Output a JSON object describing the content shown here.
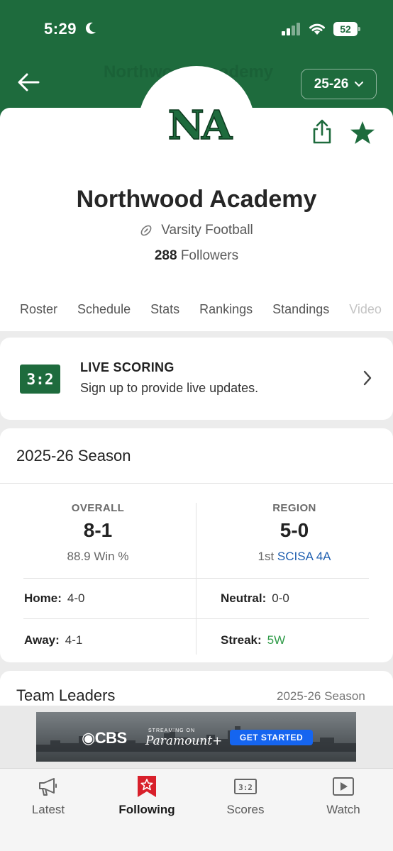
{
  "status_bar": {
    "time": "5:29",
    "battery": "52"
  },
  "header": {
    "back_label": "back",
    "ghost_title": "Northwood Academy",
    "season_selector": "25-26",
    "logo_text": "NA"
  },
  "team": {
    "name": "Northwood Academy",
    "sport": "Varsity Football",
    "followers_count": "288",
    "followers_label": "Followers"
  },
  "tabs": [
    "Roster",
    "Schedule",
    "Stats",
    "Rankings",
    "Standings",
    "Video"
  ],
  "live_scoring": {
    "icon_text": "3:2",
    "title": "LIVE SCORING",
    "subtitle": "Sign up to provide live updates."
  },
  "season": {
    "title": "2025-26 Season",
    "overall": {
      "label": "OVERALL",
      "record": "8-1",
      "win_pct": "88.9 Win %"
    },
    "region": {
      "label": "REGION",
      "record": "5-0",
      "rank": "1st",
      "league": "SCISA 4A"
    },
    "home": {
      "label": "Home:",
      "value": "4-0"
    },
    "neutral": {
      "label": "Neutral:",
      "value": "0-0"
    },
    "away": {
      "label": "Away:",
      "value": "4-1"
    },
    "streak": {
      "label": "Streak:",
      "value": "5W"
    }
  },
  "leaders": {
    "title": "Team Leaders",
    "season": "2025-26 Season"
  },
  "ad": {
    "brand": "CBS",
    "streaming": "STREAMING ON",
    "partner": "Paramount+",
    "cta": "GET STARTED"
  },
  "bottom_nav": [
    {
      "label": "Latest",
      "icon": "megaphone-icon"
    },
    {
      "label": "Following",
      "icon": "bookmark-star-icon",
      "active": true
    },
    {
      "label": "Scores",
      "icon": "scoreboard-icon",
      "icon_text": "3:2"
    },
    {
      "label": "Watch",
      "icon": "play-icon"
    }
  ],
  "colors": {
    "brand_green": "#1e6b3d",
    "active_red": "#d8202b",
    "link_blue": "#1f5fb0",
    "streak_green": "#2f9b48"
  }
}
